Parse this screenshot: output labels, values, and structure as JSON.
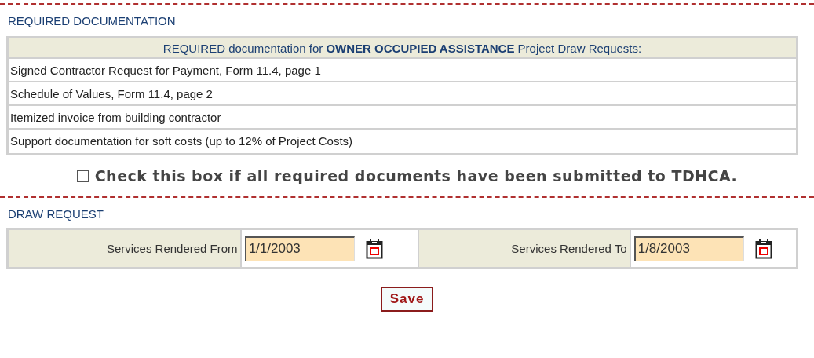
{
  "required_documentation": {
    "title": "REQUIRED DOCUMENTATION",
    "table_header": "REQUIRED documentation for **OWNER OCCUPIED ASSISTANCE** Project Draw Requests:",
    "rows": [
      "Signed Contractor Request for Payment, Form 11.4, page 1",
      "Schedule of Values, Form 11.4, page 2",
      "Itemized invoice from building contractor",
      "Support documentation for soft costs (up to 12% of Project Costs)"
    ],
    "confirmation": {
      "label": "Check this box if all required documents have been submitted to TDHCA.",
      "checked": false
    }
  },
  "draw_request": {
    "title": "DRAW REQUEST",
    "fields": [
      {
        "label": "Services Rendered From",
        "value": "1/1/2003"
      },
      {
        "label": "Services Rendered To",
        "value": "1/8/2003"
      }
    ]
  },
  "save_button": "Save"
}
